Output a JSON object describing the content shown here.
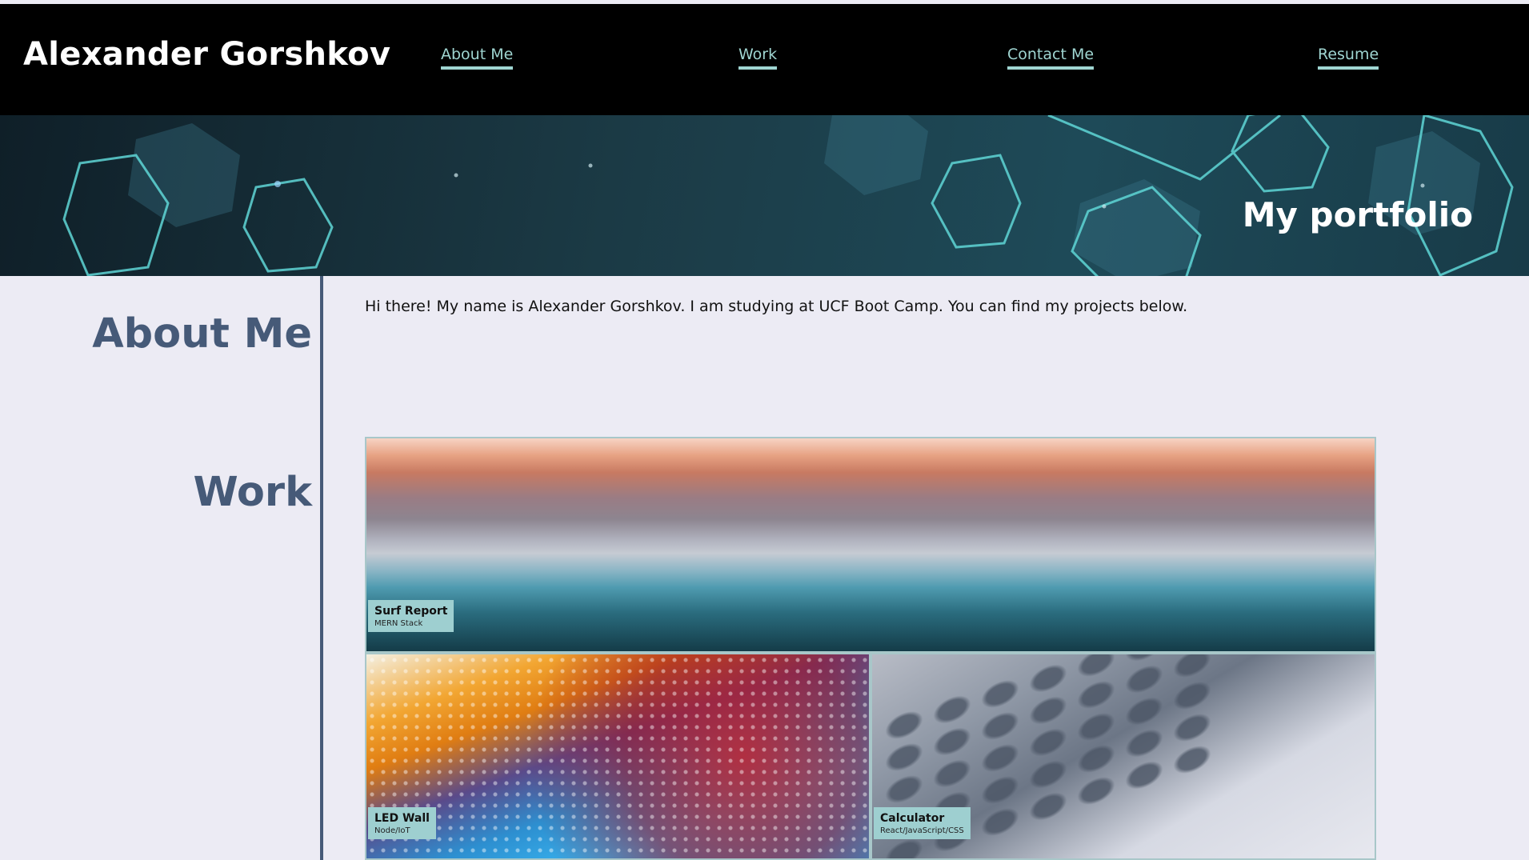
{
  "header": {
    "name": "Alexander Gorshkov",
    "nav": [
      {
        "label": "About Me"
      },
      {
        "label": "Work"
      },
      {
        "label": "Contact Me"
      },
      {
        "label": "Resume"
      }
    ]
  },
  "hero": {
    "title": "My portfolio"
  },
  "sidebar": {
    "about_heading": "About Me",
    "work_heading": "Work"
  },
  "intro": {
    "text": "Hi there! My name is Alexander Gorshkov. I am studying at UCF Boot Camp. You can find my projects below."
  },
  "projects": [
    {
      "title": "Surf Report",
      "stack": "MERN Stack"
    },
    {
      "title": "LED Wall",
      "stack": "Node/IoT"
    },
    {
      "title": "Calculator",
      "stack": "React/JavaScript/CSS"
    }
  ],
  "colors": {
    "header_bg": "#000000",
    "nav_link": "#9fd5d1",
    "page_bg": "#ecebf4",
    "heading": "#465a78",
    "label_bg": "#9ecfd0"
  }
}
